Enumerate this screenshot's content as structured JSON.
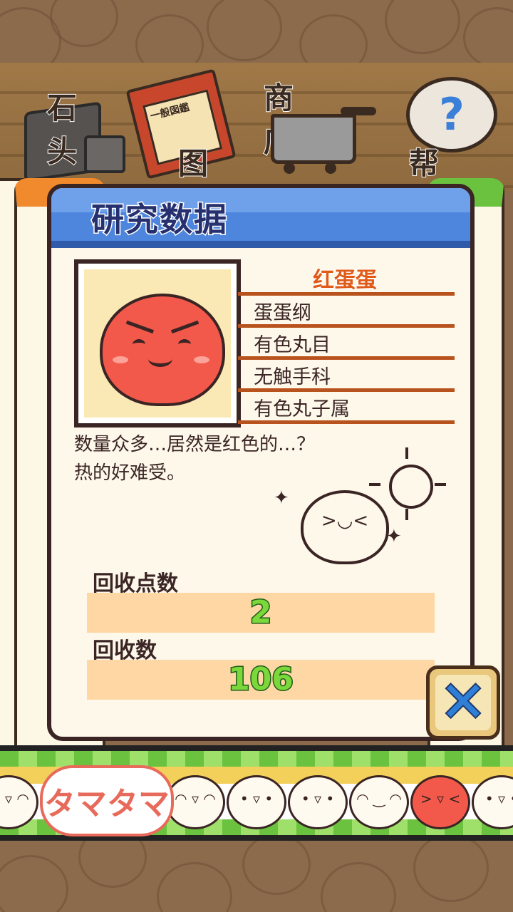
{
  "menu": {
    "stone_label": "石头",
    "guide_label": "图鉴",
    "book_cover_text": "一般図鑑",
    "shop_label": "商店",
    "help_label": "帮助",
    "help_symbol": "?"
  },
  "card": {
    "title": "研究数据",
    "egg_name": "红蛋蛋",
    "taxonomy": [
      "蛋蛋纲",
      "有色丸目",
      "无触手科",
      "有色丸子属"
    ],
    "description_lines": [
      "数量众多…居然是红色的…？",
      "热的好难受。"
    ],
    "stats": [
      {
        "label": "回收点数",
        "value": "2"
      },
      {
        "label": "回收数",
        "value": "106"
      }
    ]
  },
  "close_button": {
    "symbol": "✕",
    "icon": "close-icon"
  },
  "banner": {
    "logo_text": "タマタマ"
  },
  "colors": {
    "header_blue": "#4e86dd",
    "name_orange": "#e05a18",
    "stat_green": "#7bd83a",
    "egg_red": "#f2594a",
    "stat_bar": "#ffd7a4"
  }
}
